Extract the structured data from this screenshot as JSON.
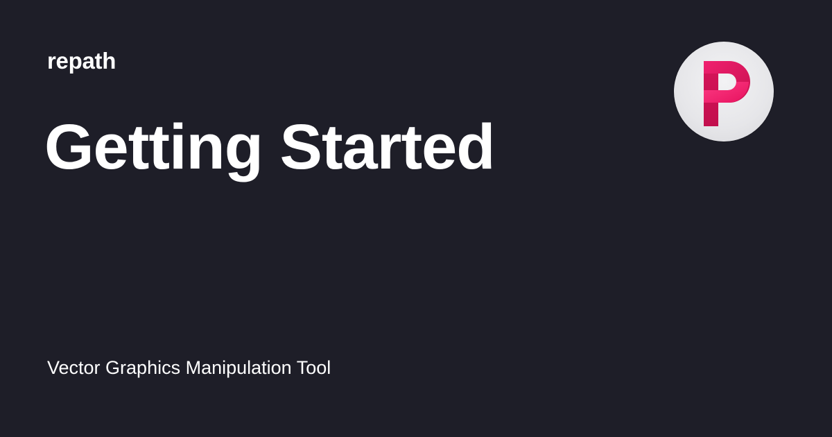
{
  "site": {
    "name": "repath"
  },
  "page": {
    "title": "Getting Started",
    "tagline": "Vector Graphics Manipulation Tool"
  },
  "logo": {
    "icon": "repath-logo-icon",
    "letter": "P",
    "brand_colors": [
      "#c4124f",
      "#ee1868",
      "#f04e8c"
    ],
    "background": "#eaeaec"
  },
  "colors": {
    "background": "#1e1e28",
    "text": "#ffffff"
  }
}
